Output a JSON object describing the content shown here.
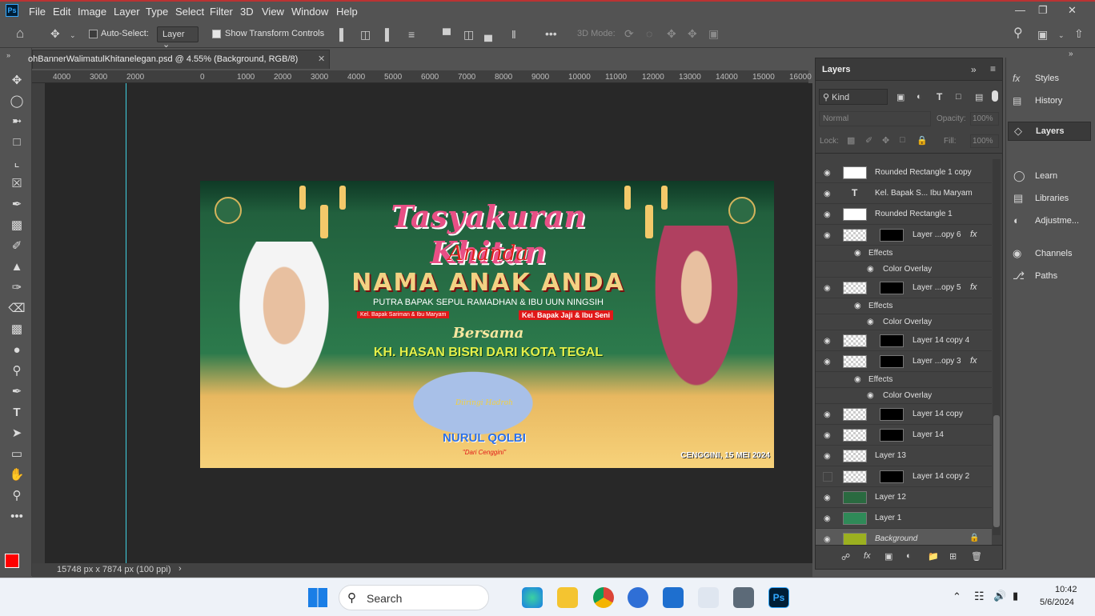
{
  "menu": [
    "File",
    "Edit",
    "Image",
    "Layer",
    "Type",
    "Select",
    "Filter",
    "3D",
    "View",
    "Window",
    "Help"
  ],
  "options": {
    "auto_select_label": "Auto-Select:",
    "auto_select_value": "Layer",
    "show_transform_label": "Show Transform Controls",
    "mode_label": "3D Mode:"
  },
  "document": {
    "tab_title": "ohBannerWalimatulKhitanelegan.psd @ 4.55% (Background, RGB/8)",
    "status": "15748 px x 7874 px (100 ppi)",
    "ruler_ticks": [
      "4000",
      "3000",
      "2000",
      "0",
      "1000",
      "2000",
      "3000",
      "4000",
      "5000",
      "6000",
      "7000",
      "8000",
      "9000",
      "10000",
      "11000",
      "12000",
      "13000",
      "14000",
      "15000",
      "16000"
    ]
  },
  "banner": {
    "title": "Tasyakuran Khitan",
    "ananda": "Ananda",
    "name": "NAMA ANAK ANDA",
    "parents": "PUTRA BAPAK SEPUL RAMADHAN & IBU UUN NINGSIH",
    "family_left": "Kel. Bapak Sariman & Ibu Maryam",
    "family_right": "Kel. Bapak Jaji & Ibu Seni",
    "bersama": "Bersama",
    "guest": "KH. HASAN BISRI DARI KOTA TEGAL",
    "group_title": "Diiringi Hadroh",
    "group_name": "NURUL QOLBI",
    "group_origin": "\"Dari Cenggini\"",
    "date": "CENGGINI, 15 MEI 2024"
  },
  "layers_panel": {
    "title": "Layers",
    "filter_kind": "Kind",
    "blend_mode": "Normal",
    "opacity_label": "Opacity:",
    "opacity_value": "100%",
    "lock_label": "Lock:",
    "fill_label": "Fill:",
    "fill_value": "100%",
    "layers": [
      {
        "name": "Rounded Rectangle 1 copy",
        "type": "shape",
        "visible": true
      },
      {
        "name": "Kel. Bapak S... Ibu Maryam",
        "type": "text",
        "visible": true
      },
      {
        "name": "Rounded Rectangle 1",
        "type": "shape",
        "visible": true
      },
      {
        "name": "Layer ...opy 6",
        "type": "masked",
        "visible": true,
        "fx": true
      },
      {
        "name": "Effects",
        "type": "effects",
        "visible": true
      },
      {
        "name": "Color Overlay",
        "type": "effect",
        "visible": true
      },
      {
        "name": "Layer ...opy 5",
        "type": "masked",
        "visible": true,
        "fx": true
      },
      {
        "name": "Effects",
        "type": "effects",
        "visible": true
      },
      {
        "name": "Color Overlay",
        "type": "effect",
        "visible": true
      },
      {
        "name": "Layer 14 copy 4",
        "type": "masked",
        "visible": true
      },
      {
        "name": "Layer ...opy 3",
        "type": "masked",
        "visible": true,
        "fx": true
      },
      {
        "name": "Effects",
        "type": "effects",
        "visible": true
      },
      {
        "name": "Color Overlay",
        "type": "effect",
        "visible": true
      },
      {
        "name": "Layer 14 copy",
        "type": "masked",
        "visible": true
      },
      {
        "name": "Layer 14",
        "type": "masked",
        "visible": true
      },
      {
        "name": "Layer 13",
        "type": "pixel",
        "visible": true
      },
      {
        "name": "Layer 14 copy 2",
        "type": "masked",
        "visible": false
      },
      {
        "name": "Layer 12",
        "type": "pixel",
        "visible": true
      },
      {
        "name": "Layer 1",
        "type": "pixel",
        "visible": true
      },
      {
        "name": "Background",
        "type": "background",
        "visible": true,
        "locked": true
      }
    ]
  },
  "right_panel": [
    "Styles",
    "History",
    "Layers",
    "Learn",
    "Libraries",
    "Adjustme...",
    "Channels",
    "Paths"
  ],
  "taskbar": {
    "search": "Search",
    "time": "10:42",
    "date": "5/6/2024"
  },
  "colors": {
    "foreground": "#ff0000",
    "background": "#ffffff",
    "accent": "#31a8ff"
  }
}
